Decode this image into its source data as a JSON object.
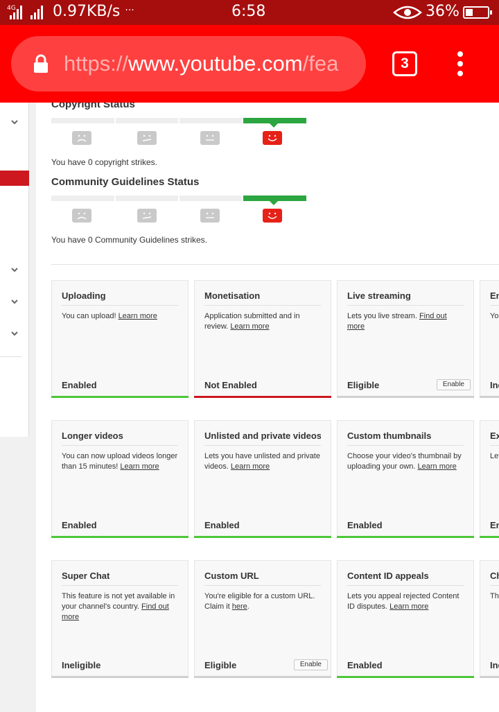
{
  "status_bar": {
    "network": "4G",
    "speed": "0.97KB/s",
    "dots": "···",
    "time": "6:58",
    "battery_pct": "36%",
    "eye_icon": "eye-icon",
    "battery_level": 0.36
  },
  "browser": {
    "url_scheme": "https://",
    "url_host": "www.youtube.com",
    "url_path": "/fea",
    "tab_count": "3",
    "lock_icon": "lock-icon",
    "menu_icon": "more-vert-icon",
    "colors": {
      "toolbar": "#fe0000",
      "urlbar": "#ff4040",
      "status": "#a60d0d"
    }
  },
  "copyright": {
    "title": "Copyright Status",
    "strikes_text": "You have 0 copyright strikes.",
    "level_index": 3
  },
  "community": {
    "title": "Community Guidelines Status",
    "strikes_text": "You have 0 Community Guidelines strikes.",
    "level_index": 3
  },
  "features": [
    {
      "title": "Uploading",
      "desc": "You can upload!",
      "link": "Learn more",
      "status": "Enabled",
      "state": "green"
    },
    {
      "title": "Monetisation",
      "desc": "Application submitted and in review.",
      "link": "Learn more",
      "status": "Not Enabled",
      "state": "red"
    },
    {
      "title": "Live streaming",
      "desc": "Lets you live stream.",
      "link": "Find out more",
      "status": "Eligible",
      "state": "gray",
      "button": "Enable"
    },
    {
      "title": "Em",
      "desc": "Yo str fea",
      "link": "",
      "status": "Ine",
      "state": "gray"
    },
    {
      "title": "Longer videos",
      "desc": "You can now upload videos longer than 15 minutes!",
      "link": "Learn more",
      "status": "Enabled",
      "state": "green"
    },
    {
      "title": "Unlisted and private videos",
      "desc": "Lets you have unlisted and private videos.",
      "link": "Learn more",
      "status": "Enabled",
      "state": "green"
    },
    {
      "title": "Custom thumbnails",
      "desc": "Choose your video's thumbnail by uploading your own.",
      "link": "Learn more",
      "status": "Enabled",
      "state": "green"
    },
    {
      "title": "Ex",
      "desc": "Let ext Le",
      "link": "",
      "status": "En",
      "state": "green"
    },
    {
      "title": "Super Chat",
      "desc": "This feature is not yet available in your channel's country.",
      "link": "Find out more",
      "status": "Ineligible",
      "state": "gray"
    },
    {
      "title": "Custom URL",
      "desc": "You're eligible for a custom URL. Claim it",
      "link": "here",
      "link_suffix": ".",
      "status": "Eligible",
      "state": "gray",
      "button": "Enable"
    },
    {
      "title": "Content ID appeals",
      "desc": "Lets you appeal rejected Content ID disputes.",
      "link": "Learn more",
      "status": "Enabled",
      "state": "green"
    },
    {
      "title": "Ch",
      "desc": "Th isn ch",
      "link": "",
      "status": "Ine",
      "state": "gray"
    }
  ]
}
